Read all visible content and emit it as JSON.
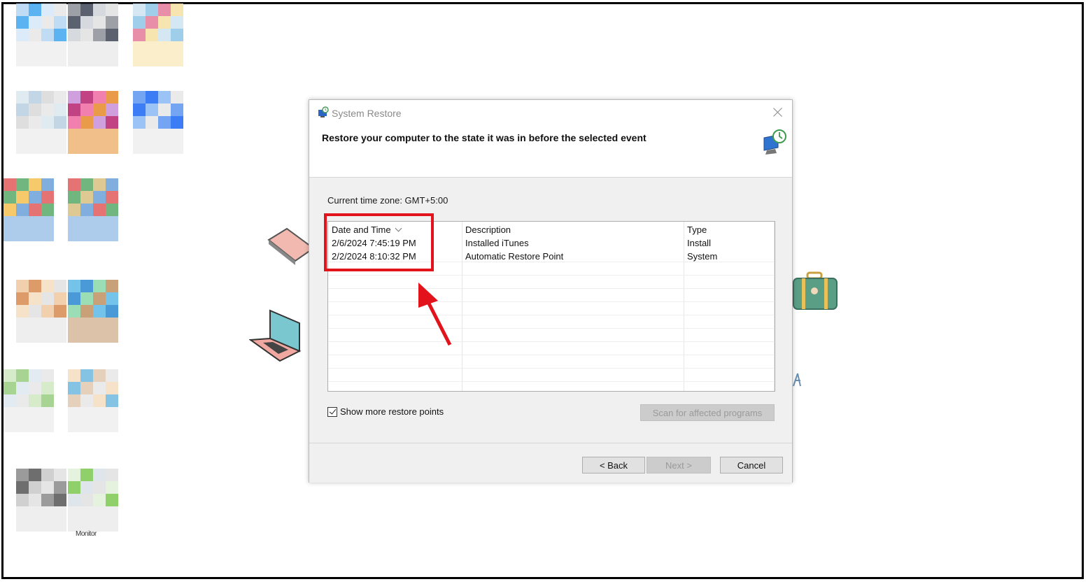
{
  "window": {
    "title": "System Restore",
    "heading": "Restore your computer to the state it was in before the selected event"
  },
  "timezone_label": "Current time zone: GMT+5:00",
  "restore_list": {
    "columns": [
      "Date and Time",
      "Description",
      "Type"
    ],
    "rows": [
      {
        "date": "2/6/2024 7:45:19 PM",
        "description": "Installed iTunes",
        "type": "Install"
      },
      {
        "date": "2/2/2024 8:10:32 PM",
        "description": "Automatic Restore Point",
        "type": "System"
      }
    ]
  },
  "show_more": {
    "label": "Show more restore points",
    "checked": true
  },
  "buttons": {
    "scan": "Scan for affected programs",
    "back": "< Back",
    "next": "Next >",
    "cancel": "Cancel"
  },
  "desktop": {
    "icon_label": "Monitor"
  },
  "colors": {
    "highlight": "#e3131b",
    "window_bg": "#f0f0f0",
    "button_bg": "#e1e1e1"
  }
}
